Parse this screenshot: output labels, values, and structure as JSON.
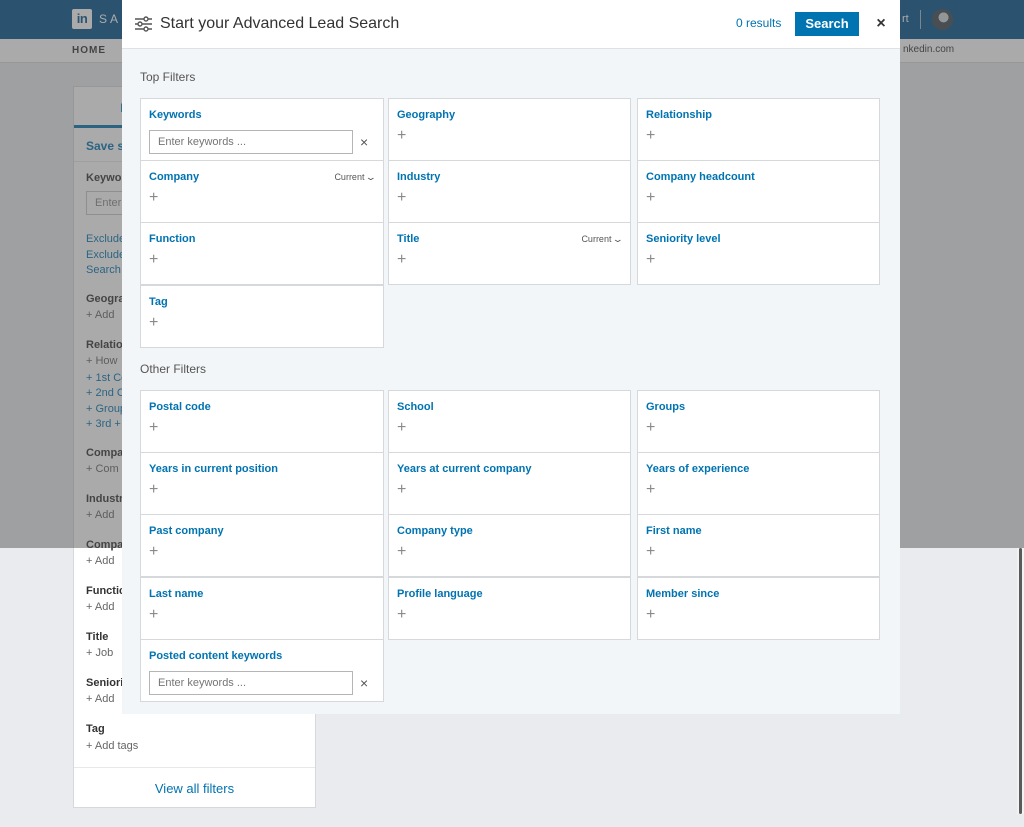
{
  "background": {
    "logo_in": "in",
    "logo_text": "SA",
    "top_right_text": "rt",
    "nav_home": "HOME",
    "nav_right": "nkedin.com",
    "left_panel": {
      "tab_fragment": "I",
      "save_search": "Save se",
      "keywords_label": "Keywo",
      "keywords_placeholder": "Enter",
      "links": [
        "Exclude",
        "Exclude",
        "Search"
      ],
      "geography_label": "Geogra",
      "geography_add": "+ Add",
      "relationship_label": "Relatio",
      "relationship_add": "+ How",
      "relationship_links": [
        "+ 1st Co",
        "+ 2nd C",
        "+ Group",
        "+ 3rd +"
      ],
      "company_label": "Compa",
      "company_add": "+ Com",
      "industry_label": "Industr",
      "industry_add": "+ Add",
      "company2_label": "Compa",
      "company2_add": "+ Add",
      "function_label": "Functic",
      "function_add": "+ Add",
      "title_label": "Title",
      "title_add": "+ Job",
      "seniority_label": "Seniori",
      "seniority_add": "+ Add",
      "tag_label": "Tag",
      "tag_add": "+ Add tags",
      "view_all": "View all filters"
    }
  },
  "modal": {
    "title": "Start your Advanced Lead Search",
    "results": "0 results",
    "search_label": "Search",
    "close_symbol": "×",
    "plus_symbol": "+",
    "clear_symbol": "×",
    "current_label": "Current",
    "chevron_symbol": "⌄",
    "top_filters_label": "Top Filters",
    "other_filters_label": "Other Filters",
    "top_filters": {
      "keywords": {
        "label": "Keywords",
        "placeholder": "Enter keywords ..."
      },
      "geography": "Geography",
      "relationship": "Relationship",
      "company": "Company",
      "industry": "Industry",
      "company_headcount": "Company headcount",
      "function": "Function",
      "title": "Title",
      "seniority_level": "Seniority level",
      "tag": "Tag"
    },
    "other_filters": {
      "postal_code": "Postal code",
      "school": "School",
      "groups": "Groups",
      "years_in_current_position": "Years in current position",
      "years_at_current_company": "Years at current company",
      "years_of_experience": "Years of experience",
      "past_company": "Past company",
      "company_type": "Company type",
      "first_name": "First name",
      "last_name": "Last name",
      "profile_language": "Profile language",
      "member_since": "Member since",
      "posted_content_keywords": {
        "label": "Posted content keywords",
        "placeholder": "Enter keywords ..."
      }
    }
  },
  "colors": {
    "linkedin_blue": "#0073b1",
    "header_blue": "#00508a",
    "modal_background": "#f3f6f8"
  }
}
